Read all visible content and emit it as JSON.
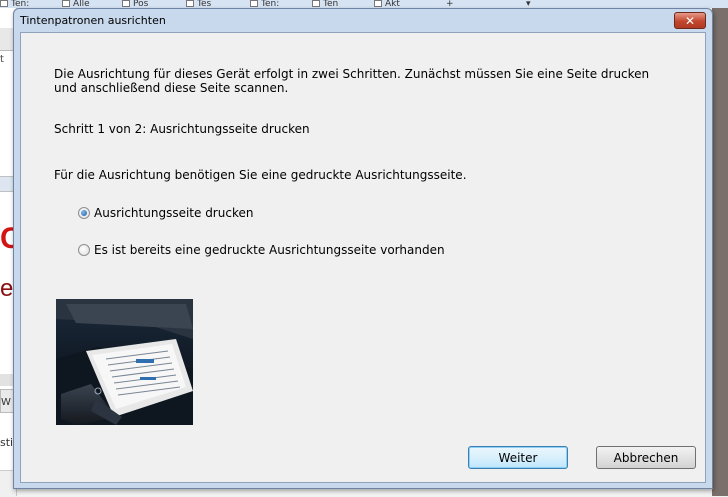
{
  "background": {
    "tabs": [
      "Ten:",
      "Alle",
      "Pos",
      "Tes",
      "Ten:",
      "Ten",
      "Akt"
    ],
    "left_fragments": {
      "line1": "t",
      "red_text": "C",
      "dark_text": "er",
      "small1": "W",
      "small2": "sti"
    }
  },
  "dialog": {
    "title": "Tintenpatronen ausrichten",
    "close_label": "✕",
    "intro": "Die Ausrichtung für dieses Gerät erfolgt in zwei Schritten. Zunächst müssen Sie eine Seite drucken und anschließend diese Seite scannen.",
    "step": "Schritt 1 von 2: Ausrichtungsseite drucken",
    "need": "Für die Ausrichtung benötigen Sie eine gedruckte Ausrichtungsseite.",
    "options": [
      {
        "label": "Ausrichtungsseite drucken",
        "selected": true
      },
      {
        "label": "Es ist bereits eine gedruckte Ausrichtungsseite vorhanden",
        "selected": false
      }
    ],
    "buttons": {
      "next": "Weiter",
      "cancel": "Abbrechen"
    }
  },
  "colors": {
    "accent": "#3c7fb1",
    "close": "#c2462e"
  }
}
